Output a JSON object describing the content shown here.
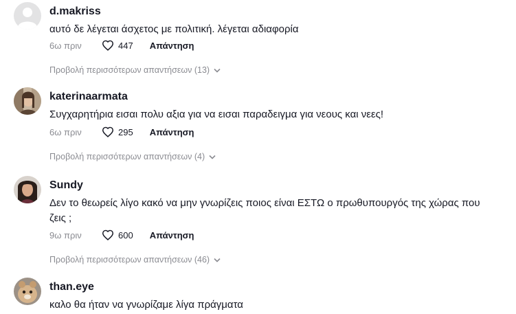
{
  "comments": [
    {
      "username": "d.makriss",
      "text": "αυτό δε λέγεται άσχετος με πολιτική. λέγεται αδιαφορία",
      "time": "6ω πριν",
      "likes": "447",
      "reply_label": "Απάντηση",
      "view_replies": "Προβολή περισσότερων απαντήσεων (13)",
      "avatar": "default-avatar"
    },
    {
      "username": "katerinaarmata",
      "text": "Συγχαρητήρια εισαι πολυ αξια για να εισαι παραδειγμα για νεους και νεες!",
      "time": "6ω πριν",
      "likes": "295",
      "reply_label": "Απάντηση",
      "view_replies": "Προβολή περισσότερων απαντήσεων (4)",
      "avatar": "photo-avatar"
    },
    {
      "username": "Sundy",
      "text": "Δεν το θεωρείς λίγο κακό να μην γνωρίζεις ποιος είναι ΕΣΤΩ ο πρωθυπουργός της χώρας που ζεις ;",
      "time": "9ω πριν",
      "likes": "600",
      "reply_label": "Απάντηση",
      "view_replies": "Προβολή περισσότερων απαντήσεων (46)",
      "avatar": "photo-avatar"
    },
    {
      "username": "than.eye",
      "text": "καλο θα ήταν να γνωρίζαμε λίγα πράγματα",
      "avatar": "photo-avatar"
    }
  ],
  "icons": {
    "like": "heart-outline-icon",
    "expand": "chevron-down-icon"
  },
  "colors": {
    "text_primary": "#161823",
    "text_secondary": "#8a8b91",
    "default_avatar_bg": "#e3e3e4"
  }
}
